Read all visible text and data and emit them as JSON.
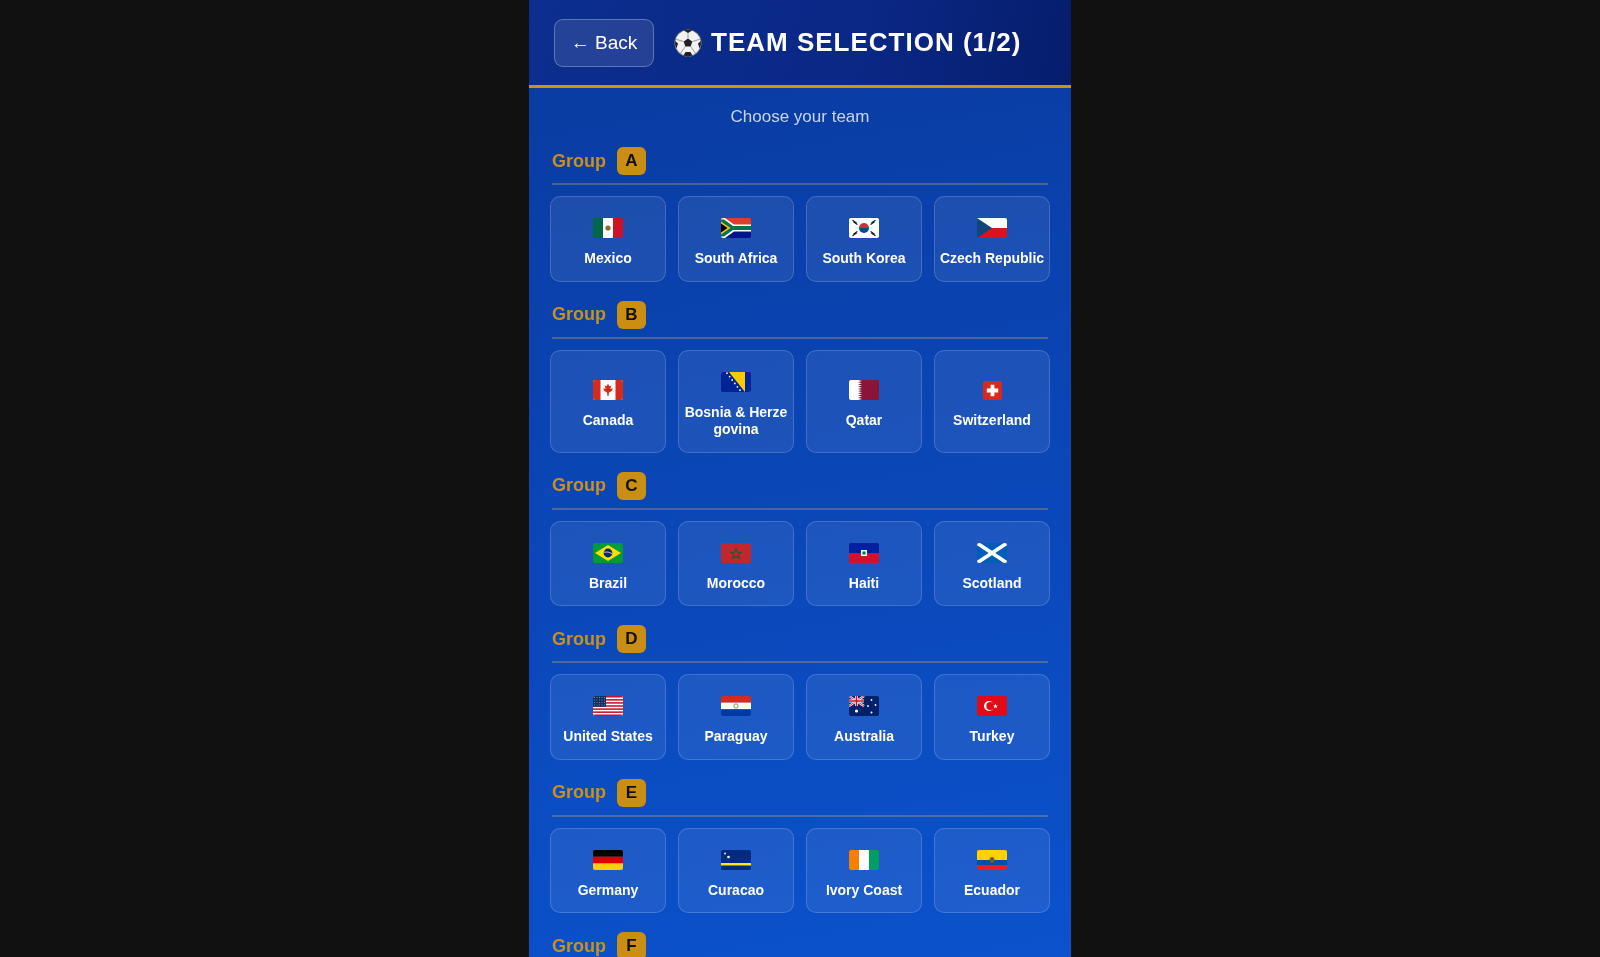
{
  "header": {
    "back_button": "← Back",
    "title": "TEAM SELECTION (1/2)"
  },
  "subtitle": "Choose your team",
  "groups": [
    {
      "label": "Group",
      "letter": "A",
      "teams": [
        {
          "name": "Mexico",
          "kind": "mx"
        },
        {
          "name": "South Africa",
          "kind": "za"
        },
        {
          "name": "South Korea",
          "kind": "kr"
        },
        {
          "name": "Czech Republic",
          "kind": "cz"
        }
      ]
    },
    {
      "label": "Group",
      "letter": "B",
      "teams": [
        {
          "name": "Canada",
          "kind": "ca"
        },
        {
          "name": "Bosnia & Herzegovina",
          "kind": "ba"
        },
        {
          "name": "Qatar",
          "kind": "qa"
        },
        {
          "name": "Switzerland",
          "kind": "ch"
        }
      ]
    },
    {
      "label": "Group",
      "letter": "C",
      "teams": [
        {
          "name": "Brazil",
          "kind": "br"
        },
        {
          "name": "Morocco",
          "kind": "ma"
        },
        {
          "name": "Haiti",
          "kind": "ht"
        },
        {
          "name": "Scotland",
          "kind": "sco"
        }
      ]
    },
    {
      "label": "Group",
      "letter": "D",
      "teams": [
        {
          "name": "United States",
          "kind": "us"
        },
        {
          "name": "Paraguay",
          "kind": "py"
        },
        {
          "name": "Australia",
          "kind": "au"
        },
        {
          "name": "Turkey",
          "kind": "tr"
        }
      ]
    },
    {
      "label": "Group",
      "letter": "E",
      "teams": [
        {
          "name": "Germany",
          "kind": "de"
        },
        {
          "name": "Curacao",
          "kind": "cw"
        },
        {
          "name": "Ivory Coast",
          "kind": "ci"
        },
        {
          "name": "Ecuador",
          "kind": "ec"
        }
      ]
    },
    {
      "label": "Group",
      "letter": "F"
    }
  ]
}
